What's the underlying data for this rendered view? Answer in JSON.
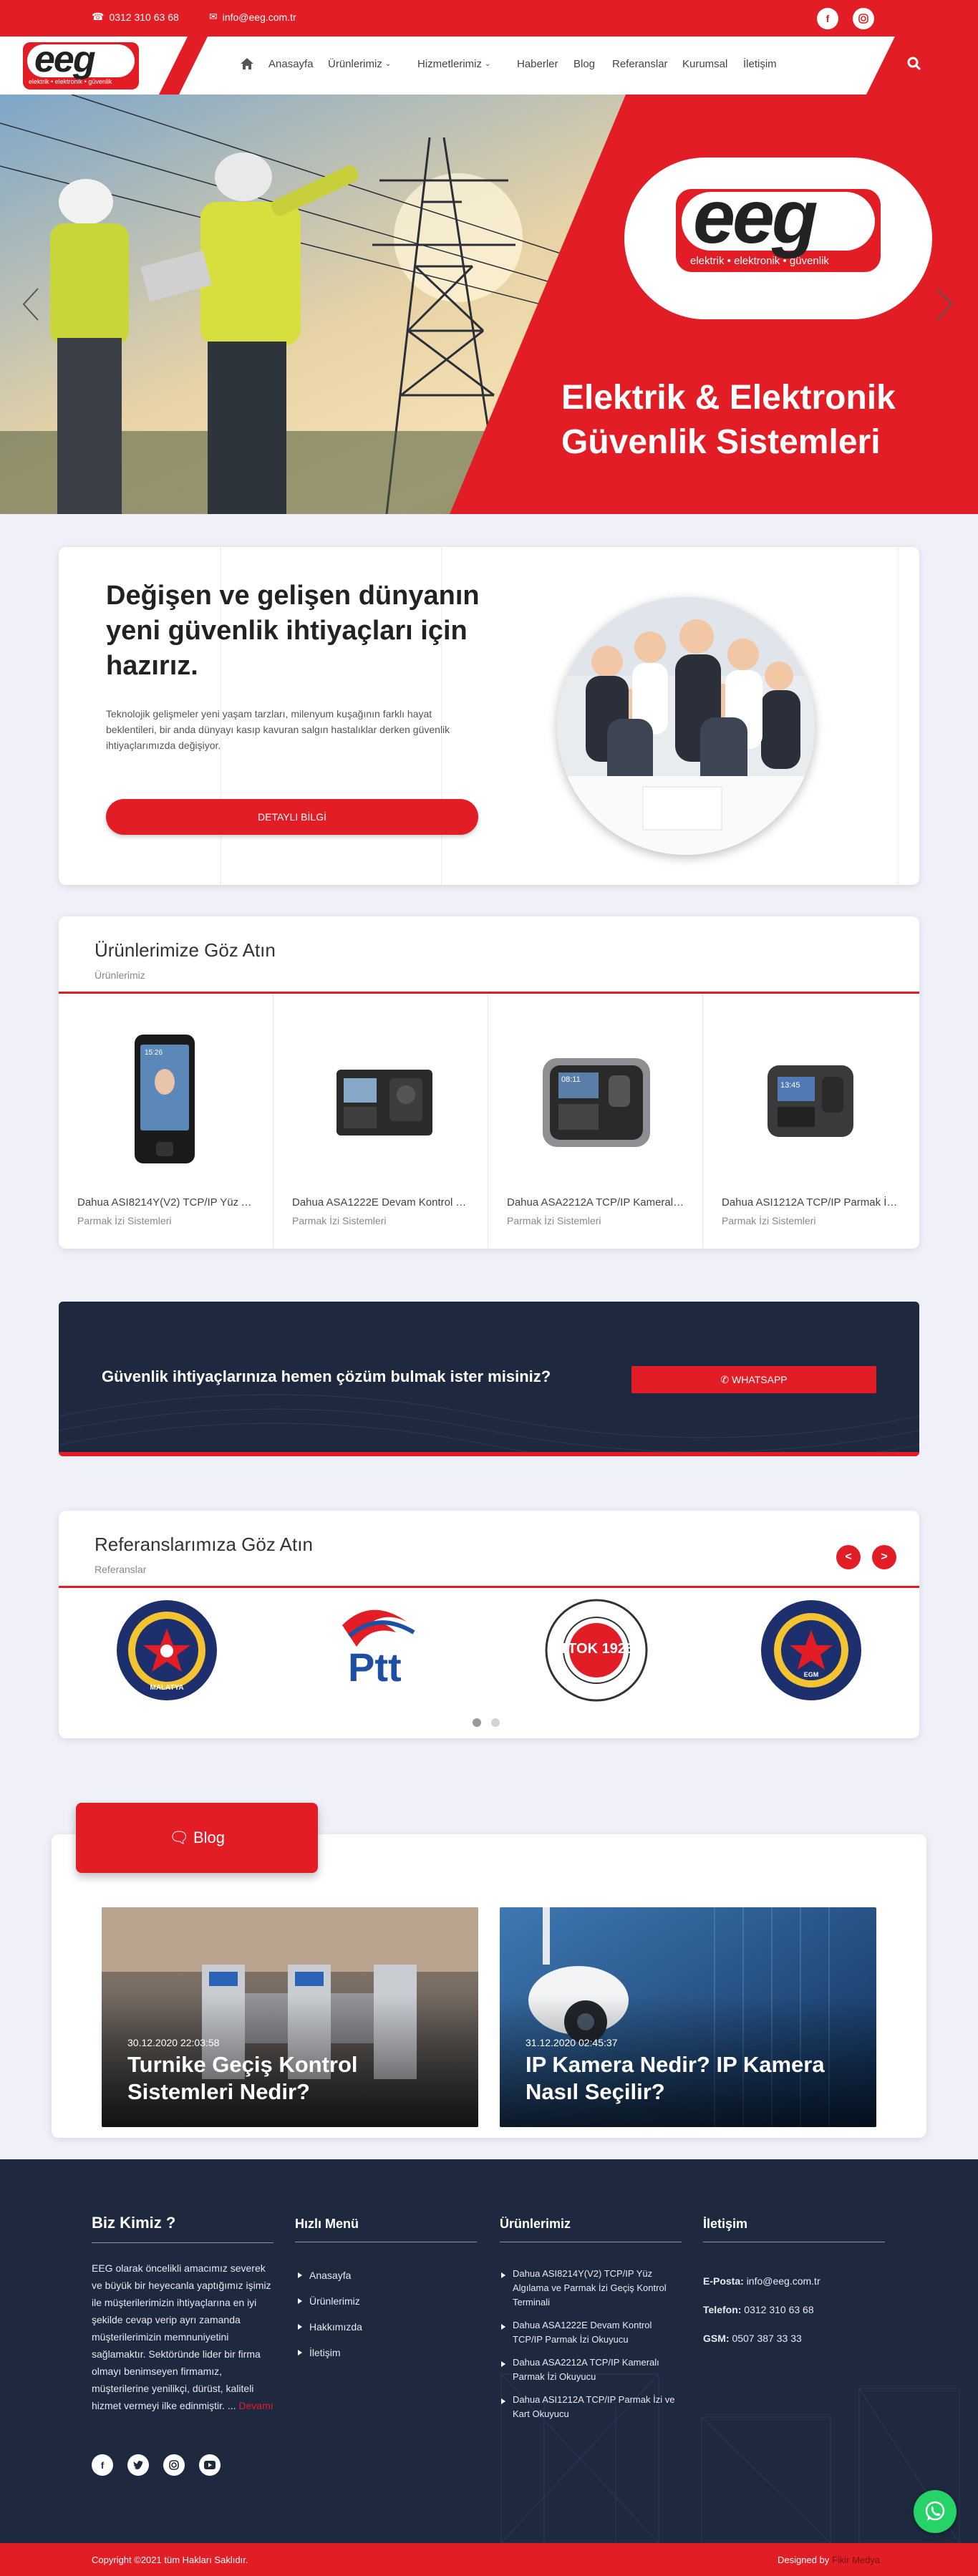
{
  "topbar": {
    "phone": "0312 310 63 68",
    "email": "info@eeg.com.tr",
    "social": [
      "facebook-icon",
      "instagram-icon"
    ]
  },
  "nav": {
    "logo_letters": "eeg",
    "logo_tagline": "elektrik • elektronik • güvenlik",
    "items": [
      {
        "label": "Anasayfa"
      },
      {
        "label": "Ürünlerimiz"
      },
      {
        "label": "Hizmetlerimiz"
      },
      {
        "label": "Haberler"
      },
      {
        "label": "Blog"
      },
      {
        "label": "Referanslar"
      },
      {
        "label": "Kurumsal"
      },
      {
        "label": "İletişim"
      }
    ]
  },
  "hero": {
    "logo_letters": "eeg",
    "logo_tagline": "elektrik • elektronik • güvenlik",
    "headline_1": "Elektrik & Elektronik",
    "headline_2": "Güvenlik Sistemleri"
  },
  "intro": {
    "title": "Değişen ve gelişen dünyanın yeni güvenlik ihtiyaçları için hazırız.",
    "text": "Teknolojik gelişmeler yeni yaşam tarzları, milenyum kuşağının farklı hayat beklentileri, bir anda dünyayı kasıp kavuran salgın hastalıklar derken güvenlik ihtiyaçlarımızda değişiyor.",
    "button": "DETAYLI BİLGİ"
  },
  "products": {
    "title": "Ürünlerimize Göz Atın",
    "subtitle": "Ürünlerimiz",
    "items": [
      {
        "name": "Dahua ASI8214Y(V2) TCP/IP Yüz Algılama ve Parmak İzi Geçiş Kontrol Terminali",
        "category": "Parmak İzi Sistemleri",
        "screen_text": "15:26"
      },
      {
        "name": "Dahua ASA1222E Devam Kontrol TCP/IP Parmak İzi Okuyucu",
        "category": "Parmak İzi Sistemleri",
        "screen_text": ""
      },
      {
        "name": "Dahua ASA2212A TCP/IP Kameralı Parmak İzi Okuyucu",
        "category": "Parmak İzi Sistemleri",
        "screen_text": "08:11"
      },
      {
        "name": "Dahua ASI1212A TCP/IP Parmak İzi ve Kart Okuyucu",
        "category": "Parmak İzi Sistemleri",
        "screen_text": "13:45"
      }
    ]
  },
  "cta": {
    "text": "Güvenlik ihtiyaçlarınıza hemen çözüm bulmak ister misiniz?",
    "button": "WHATSAPP"
  },
  "references": {
    "title": "Referanslarımıza Göz Atın",
    "subtitle": "Referanslar",
    "prev": "<",
    "next": ">",
    "logos": [
      {
        "name": "Darende İlçe Emniyet Müdürlüğü",
        "text": "MALATYA"
      },
      {
        "name": "PTT",
        "text": "Ptt"
      },
      {
        "name": "TTOK",
        "text": "TTOK 1923"
      },
      {
        "name": "Uşak Emniyet Müdürlüğü",
        "text": "EGM"
      }
    ],
    "pages": 2
  },
  "blog": {
    "tab": "Blog",
    "posts": [
      {
        "date": "30.12.2020 22:03:58",
        "title": "Turnike Geçiş Kontrol Sistemleri Nedir?"
      },
      {
        "date": "31.12.2020 02:45:37",
        "title": "IP Kamera Nedir? IP Kamera Nasıl Seçilir?"
      }
    ]
  },
  "footer": {
    "about_title": "Biz Kimiz ?",
    "about_text": "EEG  olarak öncelikli amacımız severek ve büyük bir heyecanla yaptığımız işimiz ile müşterilerimizin ihtiyaçlarına en iyi şekilde cevap verip ayrı zamanda müşterilerimizin memnuniyetini sağlamaktır. Sektöründe lider bir firma olmayı benimseyen firmamız, müşterilerine yenilikçi, dürüst, kaliteli hizmet vermeyi ilke edinmiştir. ...",
    "about_more": "Devamı",
    "social": [
      "facebook-icon",
      "twitter-icon",
      "instagram-icon",
      "youtube-icon"
    ],
    "quick_title": "Hızlı Menü",
    "quick_links": [
      "Anasayfa",
      "Ürünlerimiz",
      "Hakkımızda",
      "İletişim"
    ],
    "products_title": "Ürünlerimiz",
    "product_links": [
      "Dahua ASI8214Y(V2) TCP/IP Yüz Algılama ve Parmak İzi Geçiş Kontrol Terminali",
      "Dahua ASA1222E Devam Kontrol TCP/IP Parmak İzi Okuyucu",
      "Dahua ASA2212A TCP/IP Kameralı Parmak İzi Okuyucu",
      "Dahua ASI1212A TCP/IP Parmak İzi ve Kart Okuyucu"
    ],
    "contact_title": "İletişim",
    "email_label": "E-Posta:",
    "email": "info@eeg.com.tr",
    "phone_label": "Telefon:",
    "phone": "0312 310 63 68",
    "gsm_label": "GSM:",
    "gsm": "0507 387 33 33"
  },
  "copyright": {
    "text": "Copyright ©2021 tüm Hakları Saklıdır.",
    "designed_by": "Designed by",
    "designer": "Fikir Medya"
  },
  "colors": {
    "brand_red": "#e31d25",
    "navy": "#1e2940",
    "whatsapp": "#25d366"
  }
}
